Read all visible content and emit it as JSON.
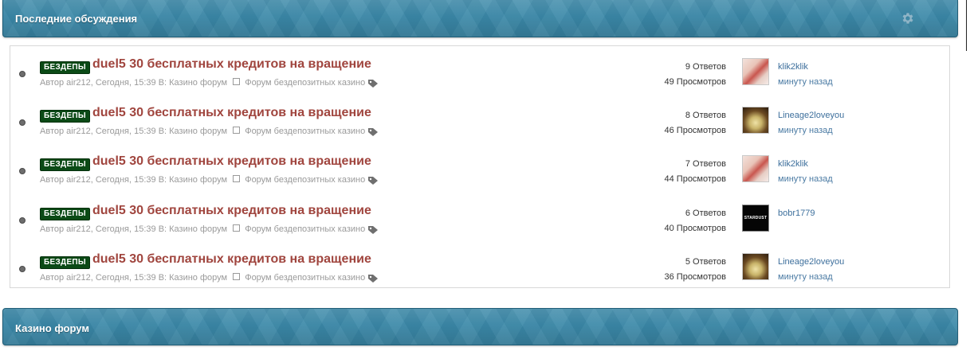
{
  "header": {
    "title": "Последние обсуждения"
  },
  "threads": [
    {
      "prefix": "БЕЗДЕПЫ",
      "title": "duel5 30 бесплатных кредитов на вращение",
      "meta_before": "Автор air212, Сегодня, 15:39 В: Казино форум",
      "meta_after": "Форум бездепозитных казино",
      "replies": "9 Ответов",
      "views": "49 Просмотров",
      "last_user": "klik2klik",
      "last_time": "минуту назад",
      "avatar_variant": "a"
    },
    {
      "prefix": "БЕЗДЕПЫ",
      "title": "duel5 30 бесплатных кредитов на вращение",
      "meta_before": "Автор air212, Сегодня, 15:39 В: Казино форум",
      "meta_after": "Форум бездепозитных казино",
      "replies": "8 Ответов",
      "views": "46 Просмотров",
      "last_user": "Lineage2loveyou",
      "last_time": "минуту назад",
      "avatar_variant": "b"
    },
    {
      "prefix": "БЕЗДЕПЫ",
      "title": "duel5 30 бесплатных кредитов на вращение",
      "meta_before": "Автор air212, Сегодня, 15:39 В: Казино форум",
      "meta_after": "Форум бездепозитных казино",
      "replies": "7 Ответов",
      "views": "44 Просмотров",
      "last_user": "klik2klik",
      "last_time": "минуту назад",
      "avatar_variant": "a"
    },
    {
      "prefix": "БЕЗДЕПЫ",
      "title": "duel5 30 бесплатных кредитов на вращение",
      "meta_before": "Автор air212, Сегодня, 15:39 В: Казино форум",
      "meta_after": "Форум бездепозитных казино",
      "replies": "6 Ответов",
      "views": "40 Просмотров",
      "last_user": "bobr1779",
      "last_time": "",
      "avatar_variant": "c",
      "avatar_text": "STARDUST"
    },
    {
      "prefix": "БЕЗДЕПЫ",
      "title": "duel5 30 бесплатных кредитов на вращение",
      "meta_before": "Автор air212, Сегодня, 15:39 В: Казино форум",
      "meta_after": "Форум бездепозитных казино",
      "replies": "5 Ответов",
      "views": "36 Просмотров",
      "last_user": "Lineage2loveyou",
      "last_time": "минуту назад",
      "avatar_variant": "b"
    }
  ],
  "section": {
    "title": "Казино форум"
  },
  "icons": {
    "settings": "gear-icon",
    "thread_status": "status-dot-icon",
    "tags": "tag-icon",
    "forum": "forum-square-icon"
  },
  "colors": {
    "header_bg": "#3a88a8",
    "prefix_bg": "#0b4a16",
    "thread_title": "#a0453e",
    "link": "#3d6f9c",
    "meta": "#9a9a9a"
  }
}
